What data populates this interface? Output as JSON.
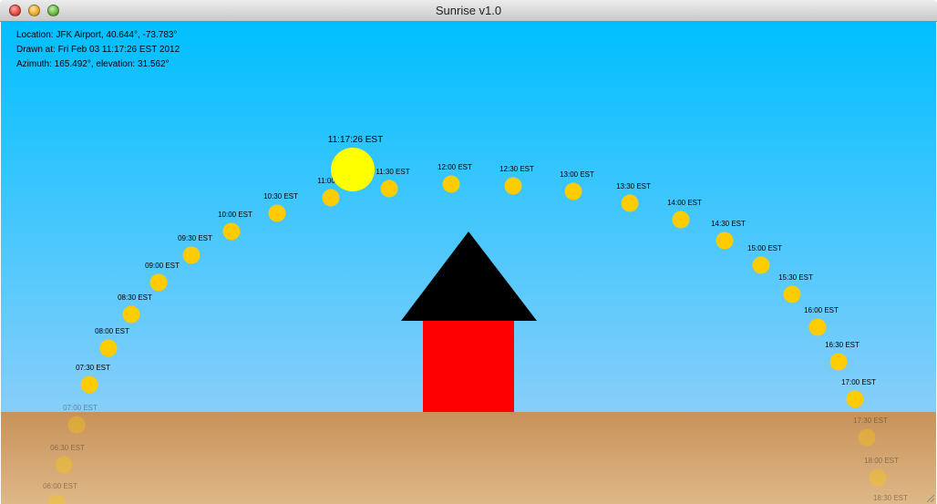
{
  "window": {
    "title": "Sunrise v1.0"
  },
  "info": {
    "location": "Location: JFK Airport, 40.644°, -73.783°",
    "drawn_at": "Drawn at: Fri Feb 03 11:17:26 EST 2012",
    "position": "Azimuth: 165.492°, elevation: 31.562°"
  },
  "current_sun": {
    "label": "11:17:26 EST",
    "color": "#ffff00"
  },
  "colors": {
    "sky_top": "#00bfff",
    "sky_bottom": "#87cefa",
    "ground_top": "#c8925a",
    "ground_bottom": "#deb887",
    "sun_marker": "#ffcc00",
    "house_roof": "#000000",
    "house_wall": "#ff0000"
  },
  "sun_positions": [
    {
      "label": "06:00 EST"
    },
    {
      "label": "06:30 EST"
    },
    {
      "label": "07:00 EST"
    },
    {
      "label": "07:30 EST"
    },
    {
      "label": "08:00 EST"
    },
    {
      "label": "08:30 EST"
    },
    {
      "label": "09:00 EST"
    },
    {
      "label": "09:30 EST"
    },
    {
      "label": "10:00 EST"
    },
    {
      "label": "10:30 EST"
    },
    {
      "label": "11:00 EST"
    },
    {
      "label": "11:30 EST"
    },
    {
      "label": "12:00 EST"
    },
    {
      "label": "12:30 EST"
    },
    {
      "label": "13:00 EST"
    },
    {
      "label": "13:30 EST"
    },
    {
      "label": "14:00 EST"
    },
    {
      "label": "14:30 EST"
    },
    {
      "label": "15:00 EST"
    },
    {
      "label": "15:30 EST"
    },
    {
      "label": "16:00 EST"
    },
    {
      "label": "16:30 EST"
    },
    {
      "label": "17:00 EST"
    },
    {
      "label": "17:30 EST"
    },
    {
      "label": "18:00 EST"
    },
    {
      "label": "18:30 EST"
    }
  ]
}
